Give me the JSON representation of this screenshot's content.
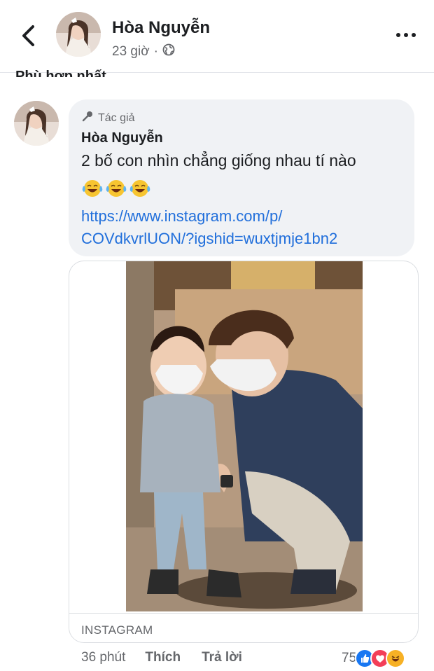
{
  "header": {
    "name": "Hòa Nguyễn",
    "time": "23 giờ",
    "separator": "·"
  },
  "section": {
    "label": "Phù hợp nhất"
  },
  "comment": {
    "badge": "Tác giả",
    "author": "Hòa Nguyễn",
    "text": "2 bố con nhìn chẳng giống nhau tí nào",
    "emojis": [
      "laughing-tears-emoji",
      "laughing-tears-emoji",
      "laughing-tears-emoji"
    ],
    "link_line1": "https://www.instagram.com/p/",
    "link_line2": "COVdkvrlUON/?igshid=wuxtjmje1bn2",
    "link_color": "#216fdb"
  },
  "preview": {
    "source": "INSTAGRAM"
  },
  "actions": {
    "time": "36 phút",
    "like": "Thích",
    "reply": "Trả lời"
  },
  "reactions": {
    "count": "75",
    "icons": [
      "like-reaction-icon",
      "love-reaction-icon",
      "haha-reaction-icon"
    ],
    "colors": {
      "like": "#1877f2",
      "love": "#f33e58",
      "haha": "#f7b125"
    }
  }
}
